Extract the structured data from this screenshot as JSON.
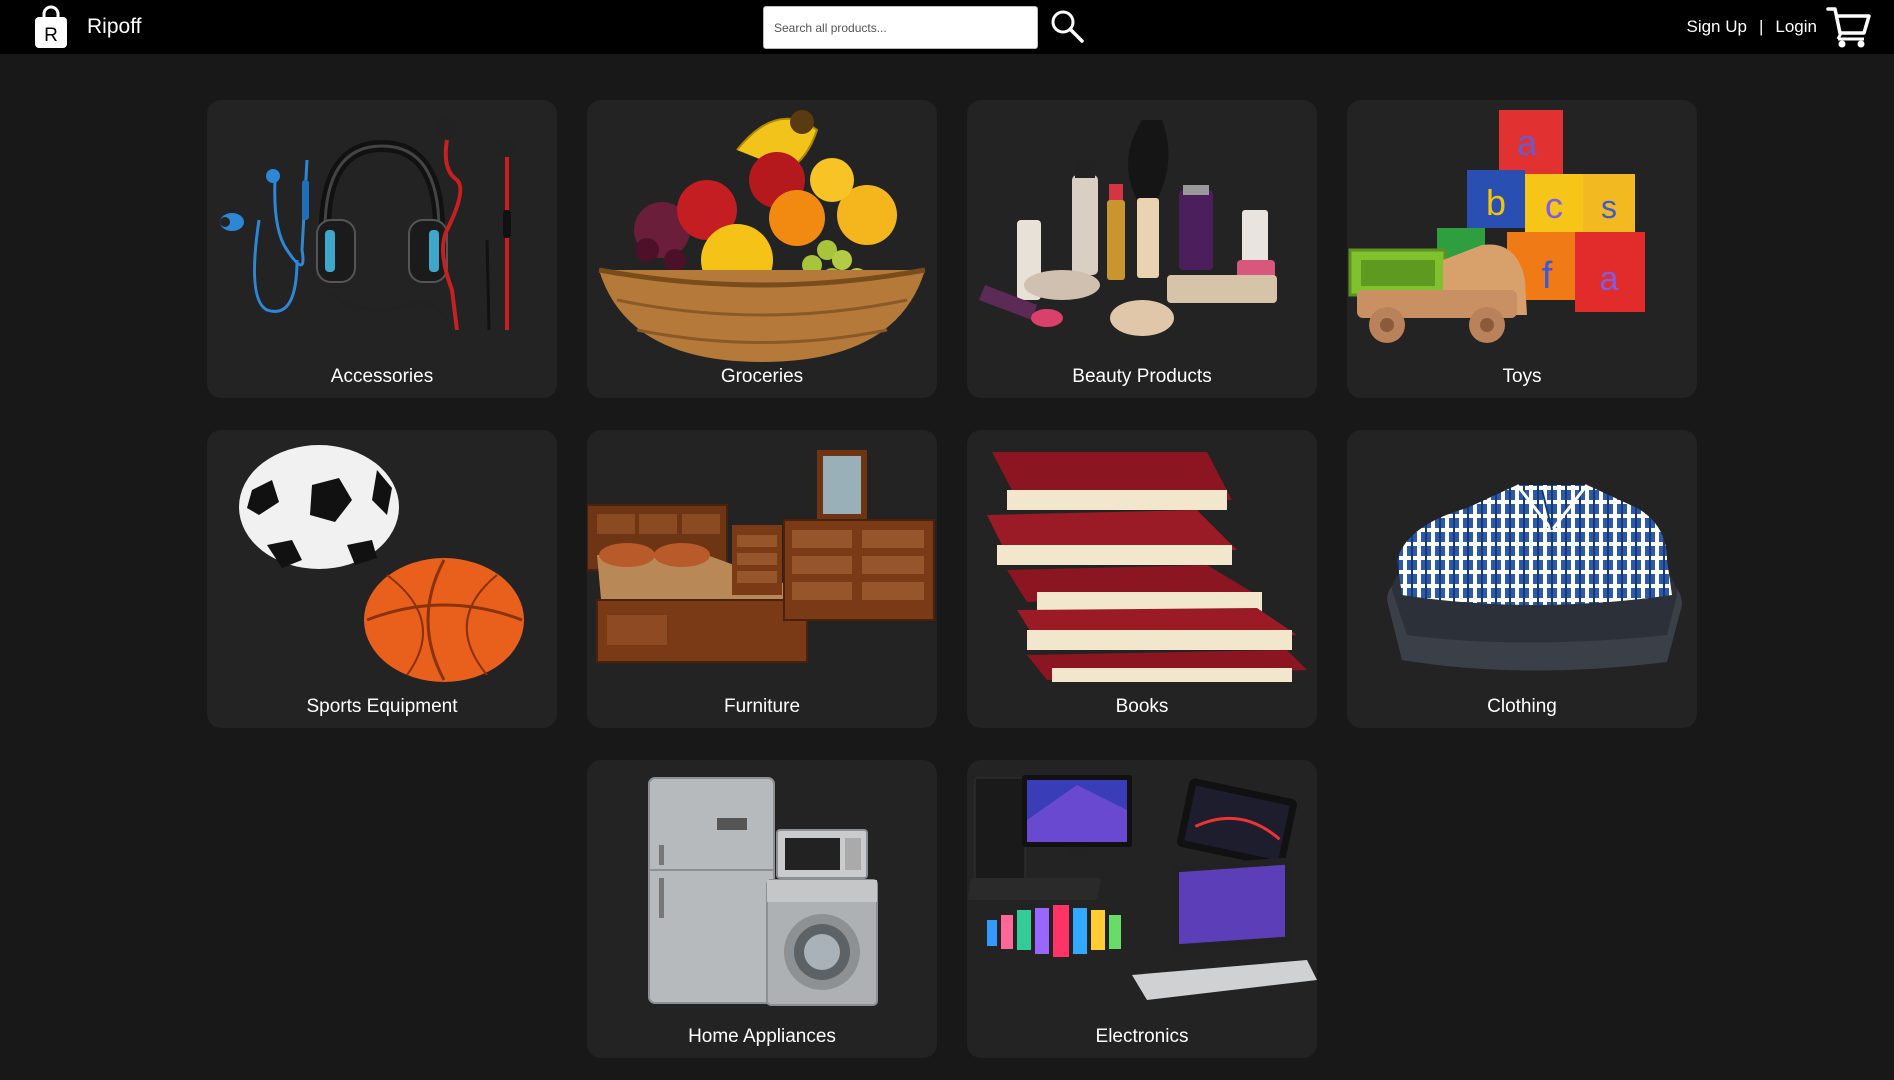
{
  "header": {
    "brand_name": "Ripoff",
    "logo_letter": "R",
    "search": {
      "placeholder": "Search all products...",
      "value": ""
    },
    "signup_label": "Sign Up",
    "separator": "|",
    "login_label": "Login",
    "icons": {
      "logo": "shopping-bag-icon",
      "search": "search-icon",
      "cart": "shopping-cart-icon"
    }
  },
  "categories": [
    {
      "label": "Accessories",
      "image": "headphones-earphones"
    },
    {
      "label": "Groceries",
      "image": "fruit-basket"
    },
    {
      "label": "Beauty Products",
      "image": "cosmetics"
    },
    {
      "label": "Toys",
      "image": "toy-blocks-truck"
    },
    {
      "label": "Sports Equipment",
      "image": "soccer-basketball"
    },
    {
      "label": "Furniture",
      "image": "bedroom-set"
    },
    {
      "label": "Books",
      "image": "stack-of-books"
    },
    {
      "label": "Clothing",
      "image": "folded-shirts"
    },
    {
      "label": "Home Appliances",
      "image": "fridge-washer-microwave"
    },
    {
      "label": "Electronics",
      "image": "computers-phones"
    }
  ],
  "colors": {
    "background": "#181818",
    "header": "#000000",
    "card": "#232323",
    "text": "#ffffff"
  }
}
